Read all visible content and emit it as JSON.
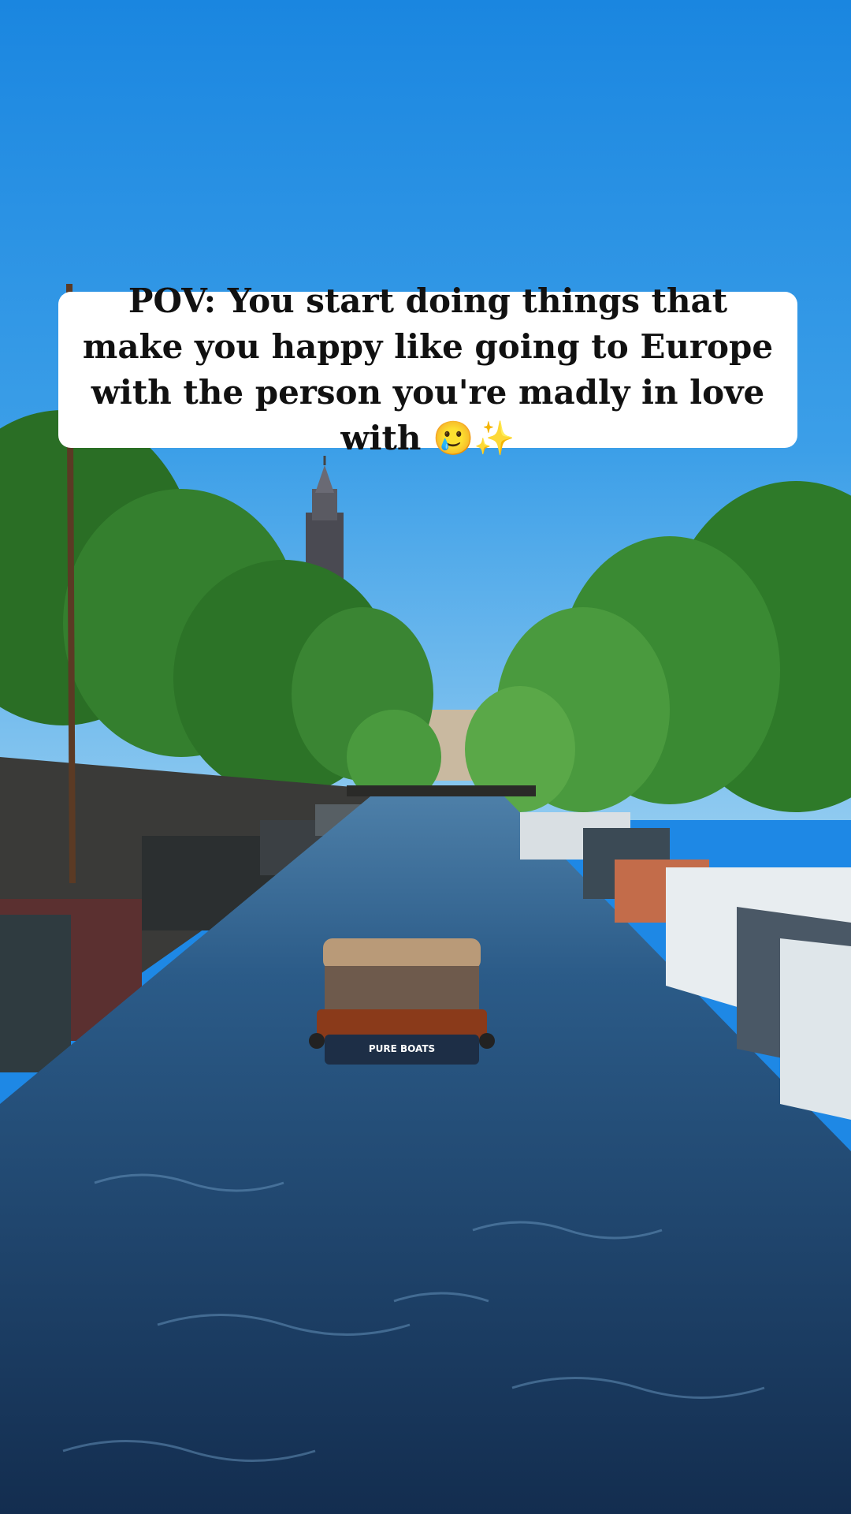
{
  "caption": {
    "text": "POV: You start doing things that make you happy like going to Europe with the person you're madly in love with 🥲✨"
  },
  "scene": {
    "subject": "canal-boat-photo",
    "boat_label": "PURE BOATS",
    "colors": {
      "sky_top": "#1a86e0",
      "sky_bottom": "#7cc2ef",
      "water": "#1d3f66",
      "trees": "#2f7d2a",
      "boat_body": "#7a3a1c",
      "houseboat": "#e8edf0"
    }
  }
}
